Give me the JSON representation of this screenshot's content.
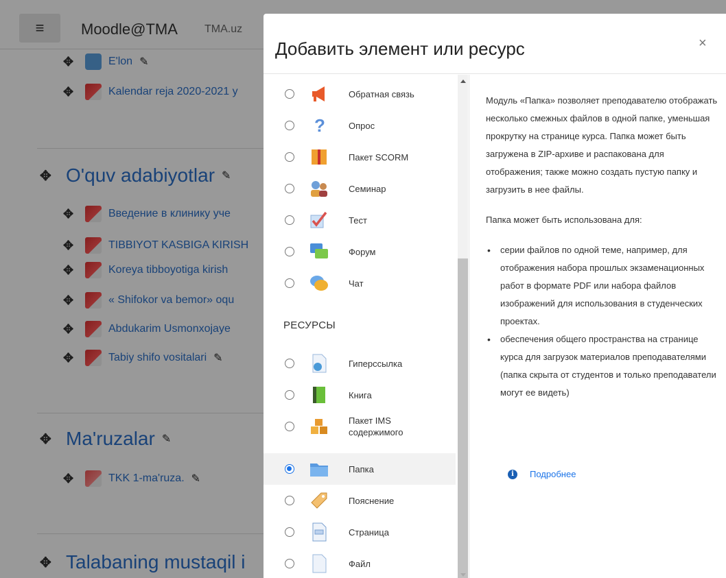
{
  "navbar": {
    "menu_icon": "hamburger-icon",
    "brand": "Moodle@TMA",
    "brand_sub": "TMA.uz"
  },
  "course": {
    "top_items": [
      {
        "label": "E'lon",
        "icon": "forum-icon"
      },
      {
        "label": "Kalendar reja 2020-2021 y",
        "icon": "pdf-icon"
      }
    ],
    "sections": [
      {
        "title": "O'quv adabiyotlar",
        "items": [
          "Введение в клинику уче",
          "TIBBIYOT KASBIGA KIRISH",
          "Koreya tibboyotiga kirish",
          "« Shifokor va bemor» oqu",
          "Abdukarim Usmonxojaye",
          "Tabiy shifo vositalari"
        ]
      },
      {
        "title": "Ma'ruzalar",
        "items": [
          "TKK 1-ma'ruza."
        ]
      },
      {
        "title": "Talabaning mustaqil i",
        "items": []
      }
    ]
  },
  "modal": {
    "title": "Добавить элемент или ресурс",
    "close_label": "×",
    "activities": [
      {
        "label": "Обратная связь",
        "icon": "megaphone-icon"
      },
      {
        "label": "Опрос",
        "icon": "question-icon"
      },
      {
        "label": "Пакет SCORM",
        "icon": "package-icon"
      },
      {
        "label": "Семинар",
        "icon": "people-icon"
      },
      {
        "label": "Тест",
        "icon": "checkmark-icon"
      },
      {
        "label": "Форум",
        "icon": "forum-icon"
      },
      {
        "label": "Чат",
        "icon": "chat-icon"
      }
    ],
    "resources_heading": "РЕСУРСЫ",
    "resources": [
      {
        "label": "Гиперссылка",
        "icon": "globe-page-icon"
      },
      {
        "label": "Книга",
        "icon": "book-icon"
      },
      {
        "label": "Пакет IMS содержимого",
        "icon": "boxes-icon"
      },
      {
        "label": "Папка",
        "icon": "folder-icon",
        "selected": true
      },
      {
        "label": "Пояснение",
        "icon": "label-tag-icon"
      },
      {
        "label": "Страница",
        "icon": "page-icon"
      },
      {
        "label": "Файл",
        "icon": "file-icon"
      }
    ],
    "description": {
      "p1": "Модуль «Папка» позволяет преподавателю отображать несколько смежных файлов в одной папке, уменьшая прокрутку на странице курса. Папка может быть загружена в ZIP-архиве и распакована для отображения; также можно создать пустую папку и загрузить в нее файлы.",
      "p2": "Папка может быть использована для:",
      "bullets": [
        "серии файлов по одной теме, например, для отображения набора прошлых экзаменационных работ в формате PDF или набора файлов изображений для использования в студенческих проектах.",
        "обеспечения общего пространства на странице курса для загрузок материалов преподавателями (папка скрыта от студентов и только преподаватели могут ее видеть)"
      ]
    },
    "more_link": "Подробнее"
  },
  "colors": {
    "link": "#2a6fc9",
    "accent": "#1a73e8"
  }
}
